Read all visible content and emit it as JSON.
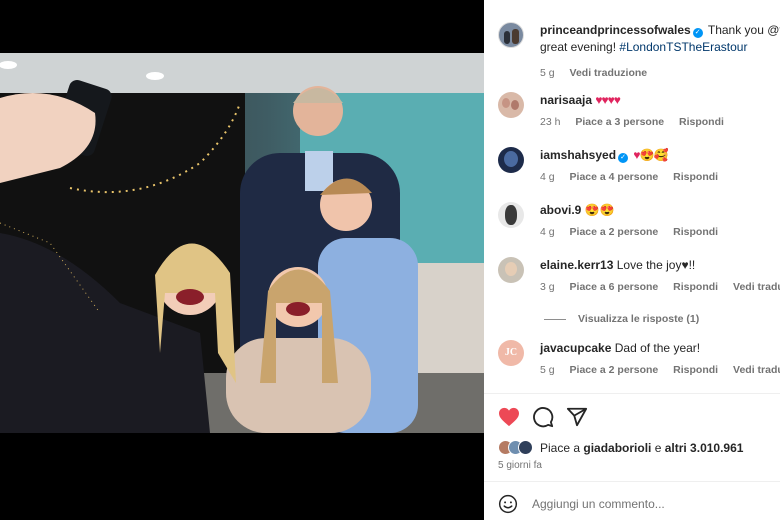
{
  "post": {
    "username": "princeandprincessofwales",
    "caption_text": "Thank you @ta",
    "caption_line2": "great evening! ",
    "hashtag": "#LondonTSTheErastour",
    "time": "5 g",
    "translate": "Vedi traduzione"
  },
  "comments": [
    {
      "username": "narisaaja",
      "text": "♥♥♥♥",
      "time": "23 h",
      "likes": "Piace a 3 persone",
      "reply": "Rispondi",
      "translate": ""
    },
    {
      "username": "iamshahsyed",
      "verified": true,
      "text": "♥😍🥰",
      "time": "4 g",
      "likes": "Piace a 4 persone",
      "reply": "Rispondi",
      "translate": ""
    },
    {
      "username": "abovi.9",
      "text": "😍😍",
      "time": "4 g",
      "likes": "Piace a 2 persone",
      "reply": "Rispondi",
      "translate": ""
    },
    {
      "username": "elaine.kerr13",
      "text": "Love the joy♥!!",
      "time": "3 g",
      "likes": "Piace a 6 persone",
      "reply": "Rispondi",
      "translate": "Vedi traduzio"
    },
    {
      "username": "javacupcake",
      "text": "Dad of the year!",
      "time": "5 g",
      "likes": "Piace a 2 persone",
      "reply": "Rispondi",
      "translate": "Vedi traduzio"
    }
  ],
  "view_replies": "Visualizza le risposte (1)",
  "likes_summary": {
    "prefix": "Piace a ",
    "user": "giadaborioli",
    "middle": " e ",
    "others": "altri 3.010.961"
  },
  "posted_ago": "5 giorni fa",
  "add_comment_placeholder": "Aggiungi un commento...",
  "avatar_initials": {
    "javacupcake": "JC"
  },
  "icons": [
    "heart-filled-icon",
    "comment-icon",
    "share-icon",
    "smile-icon",
    "verified-icon"
  ],
  "colors": {
    "heart": "#ed4956",
    "hashtag": "#00376b",
    "verified": "#0095f6",
    "muted": "#737373"
  }
}
